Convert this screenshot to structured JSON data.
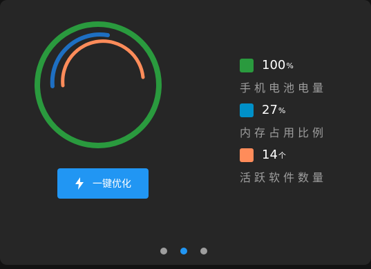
{
  "gauge": {
    "ring_color": "#2a9a3e",
    "battery_color": "#1e6fc2",
    "app_color": "#ff8c5a",
    "battery_percent": 100,
    "memory_percent": 27,
    "active_apps": 14
  },
  "optimize_button": {
    "label": "一键优化",
    "icon": "lightning-bolt-icon",
    "color": "#2196f3"
  },
  "legend": [
    {
      "color": "#2a9a3e",
      "value": "100",
      "unit": "%",
      "label": "手机电池电量"
    },
    {
      "color": "#0090c8",
      "value": "27",
      "unit": "%",
      "label": "内存占用比例"
    },
    {
      "color": "#ff8c5a",
      "value": "14",
      "unit": "个",
      "label": "活跃软件数量"
    }
  ],
  "pager": {
    "page_count": 3,
    "active_page": 2
  }
}
